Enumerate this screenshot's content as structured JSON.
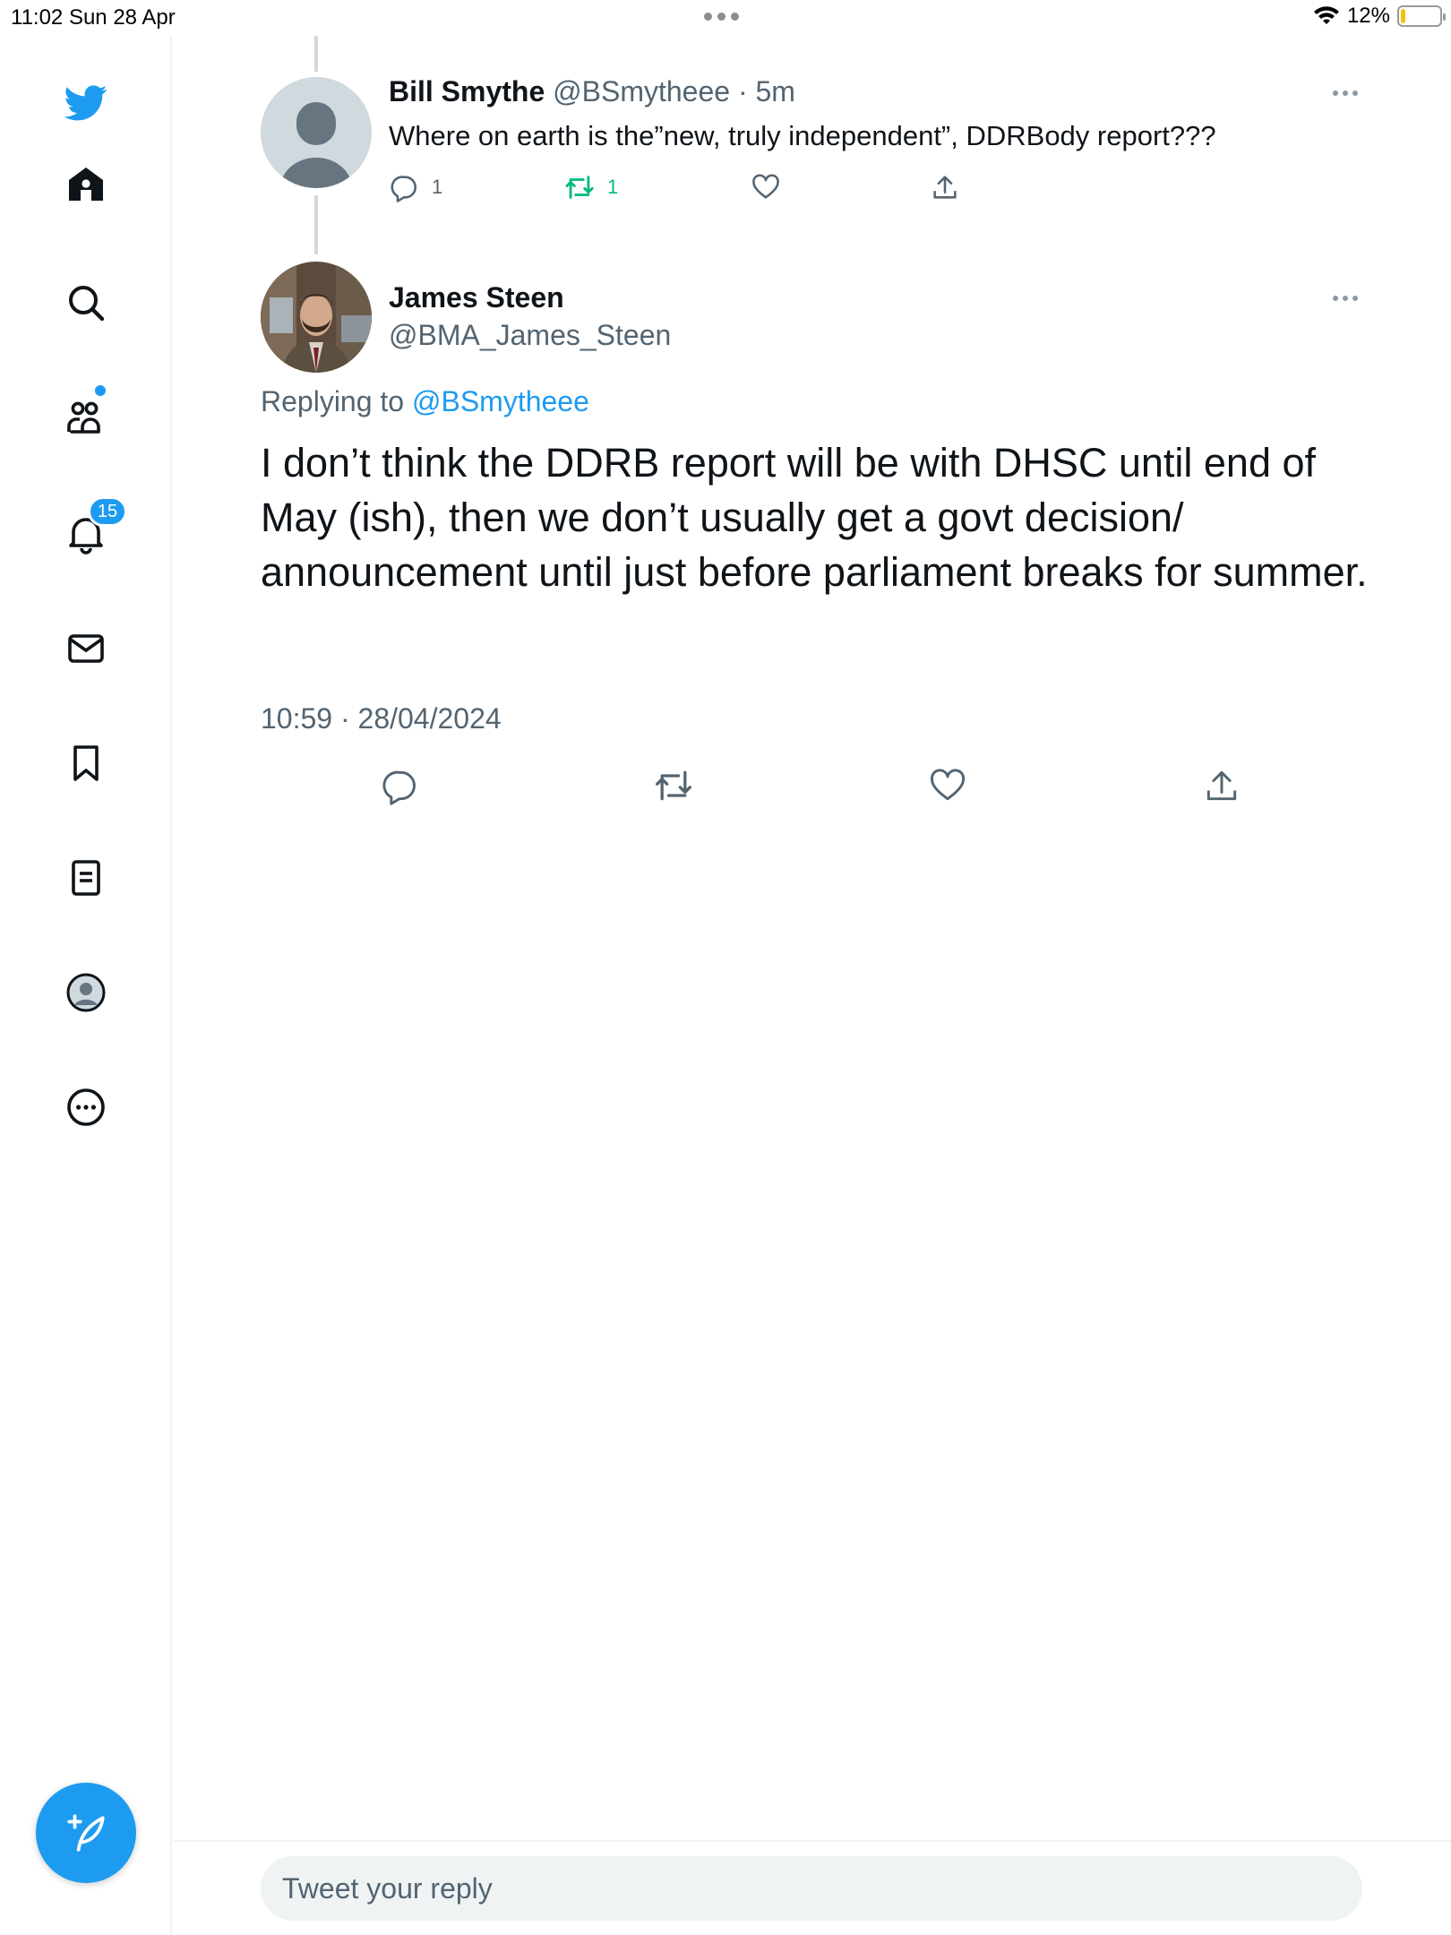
{
  "status_bar": {
    "time_date": "11:02   Sun 28 Apr",
    "battery": "12%",
    "battery_level": 0.12
  },
  "sidebar": {
    "items": [
      {
        "name": "twitter-logo-icon"
      },
      {
        "name": "home-icon"
      },
      {
        "name": "search-icon"
      },
      {
        "name": "communities-icon"
      },
      {
        "name": "notifications-icon"
      },
      {
        "name": "messages-icon"
      },
      {
        "name": "bookmarks-icon"
      },
      {
        "name": "lists-icon"
      },
      {
        "name": "profile-icon"
      },
      {
        "name": "more-icon"
      }
    ],
    "notifications_badge": "15",
    "accent_color": "#1d9bf0"
  },
  "tweet_parent": {
    "author_name": "Bill Smythe",
    "author_handle": "@BSmytheee",
    "time_ago": "5m",
    "text": "Where on earth is the”new, truly independent”, DDRBody report???",
    "reply_count": "1",
    "retweet_count": "1"
  },
  "tweet_main": {
    "author_name": "James Steen",
    "author_handle": "@BMA_James_Steen",
    "replying_to_label": "Replying to",
    "replying_to_handle": "@BSmytheee",
    "text": "I don’t think the DDRB report will be with DHSC until end of May (ish), then we don’t usually get a govt decision/ announcement until just before parliament breaks for summer.",
    "timestamp": "10:59 · 28/04/2024"
  },
  "reply_box": {
    "placeholder": "Tweet your reply"
  }
}
